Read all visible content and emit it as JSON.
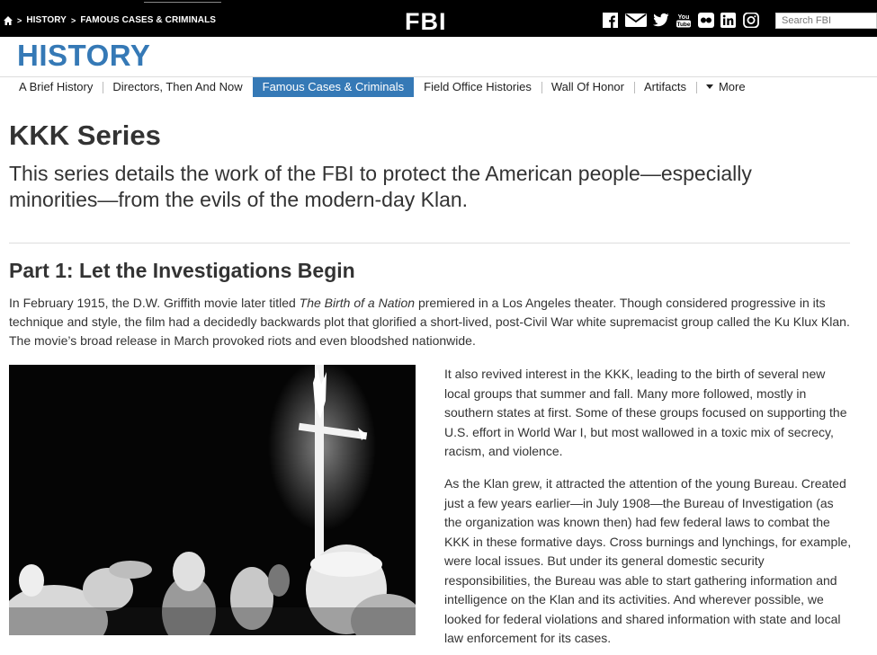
{
  "topbar": {
    "breadcrumb": [
      "HISTORY",
      "FAMOUS CASES & CRIMINALS"
    ],
    "breadcrumb_sep": ">",
    "logo": "FBI",
    "social_icons": [
      "facebook-icon",
      "email-icon",
      "twitter-icon",
      "youtube-icon",
      "flickr-icon",
      "linkedin-icon",
      "instagram-icon"
    ],
    "youtube_text": "You Tube",
    "search_placeholder": "Search FBI"
  },
  "header": {
    "section_title": "HISTORY"
  },
  "nav": {
    "items": [
      "A Brief History",
      "Directors, Then And Now",
      "Famous Cases & Criminals",
      "Field Office Histories",
      "Wall Of Honor",
      "Artifacts",
      "More"
    ],
    "active_index": 2
  },
  "main": {
    "title": "KKK Series",
    "lead": "This series details the work of the FBI to protect the American people—especially minorities—from the evils of the modern-day Klan.",
    "part_title": "Part 1: Let the Investigations Begin",
    "intro_before": "In February 1915, the D.W. Griffith movie later titled ",
    "intro_italic": "The Birth of a Nation",
    "intro_after": " premiered in a Los Angeles theater. Though considered progressive in its technique and style, the film had a decidedly backwards plot that glorified a short-lived, post-Civil War white supremacist group called the Ku Klux Klan. The movie’s broad release in March provoked riots and even bloodshed nationwide.",
    "para1": "It also revived interest in the KKK, leading to the birth of several new local groups that summer and fall. Many more followed, mostly in southern states at first. Some of these groups focused on supporting the U.S. effort in World War I, but most wallowed in a toxic mix of secrecy, racism, and violence.",
    "para2": "As the Klan grew, it attracted the attention of the young Bureau. Created just a few years earlier—in July 1908—the Bureau of Investigation (as the organization was known then) had few federal laws to combat the KKK in these formative days. Cross burnings and lynchings, for example, were local issues. But under its general domestic security responsibilities, the Bureau was able to start gathering information and intelligence on the Klan and its activities. And wherever possible, we looked for federal violations and shared information with state and local law enforcement for its cases."
  },
  "colors": {
    "brand_blue": "#3579b6",
    "topbar_bg": "#000000",
    "text": "#333333"
  }
}
